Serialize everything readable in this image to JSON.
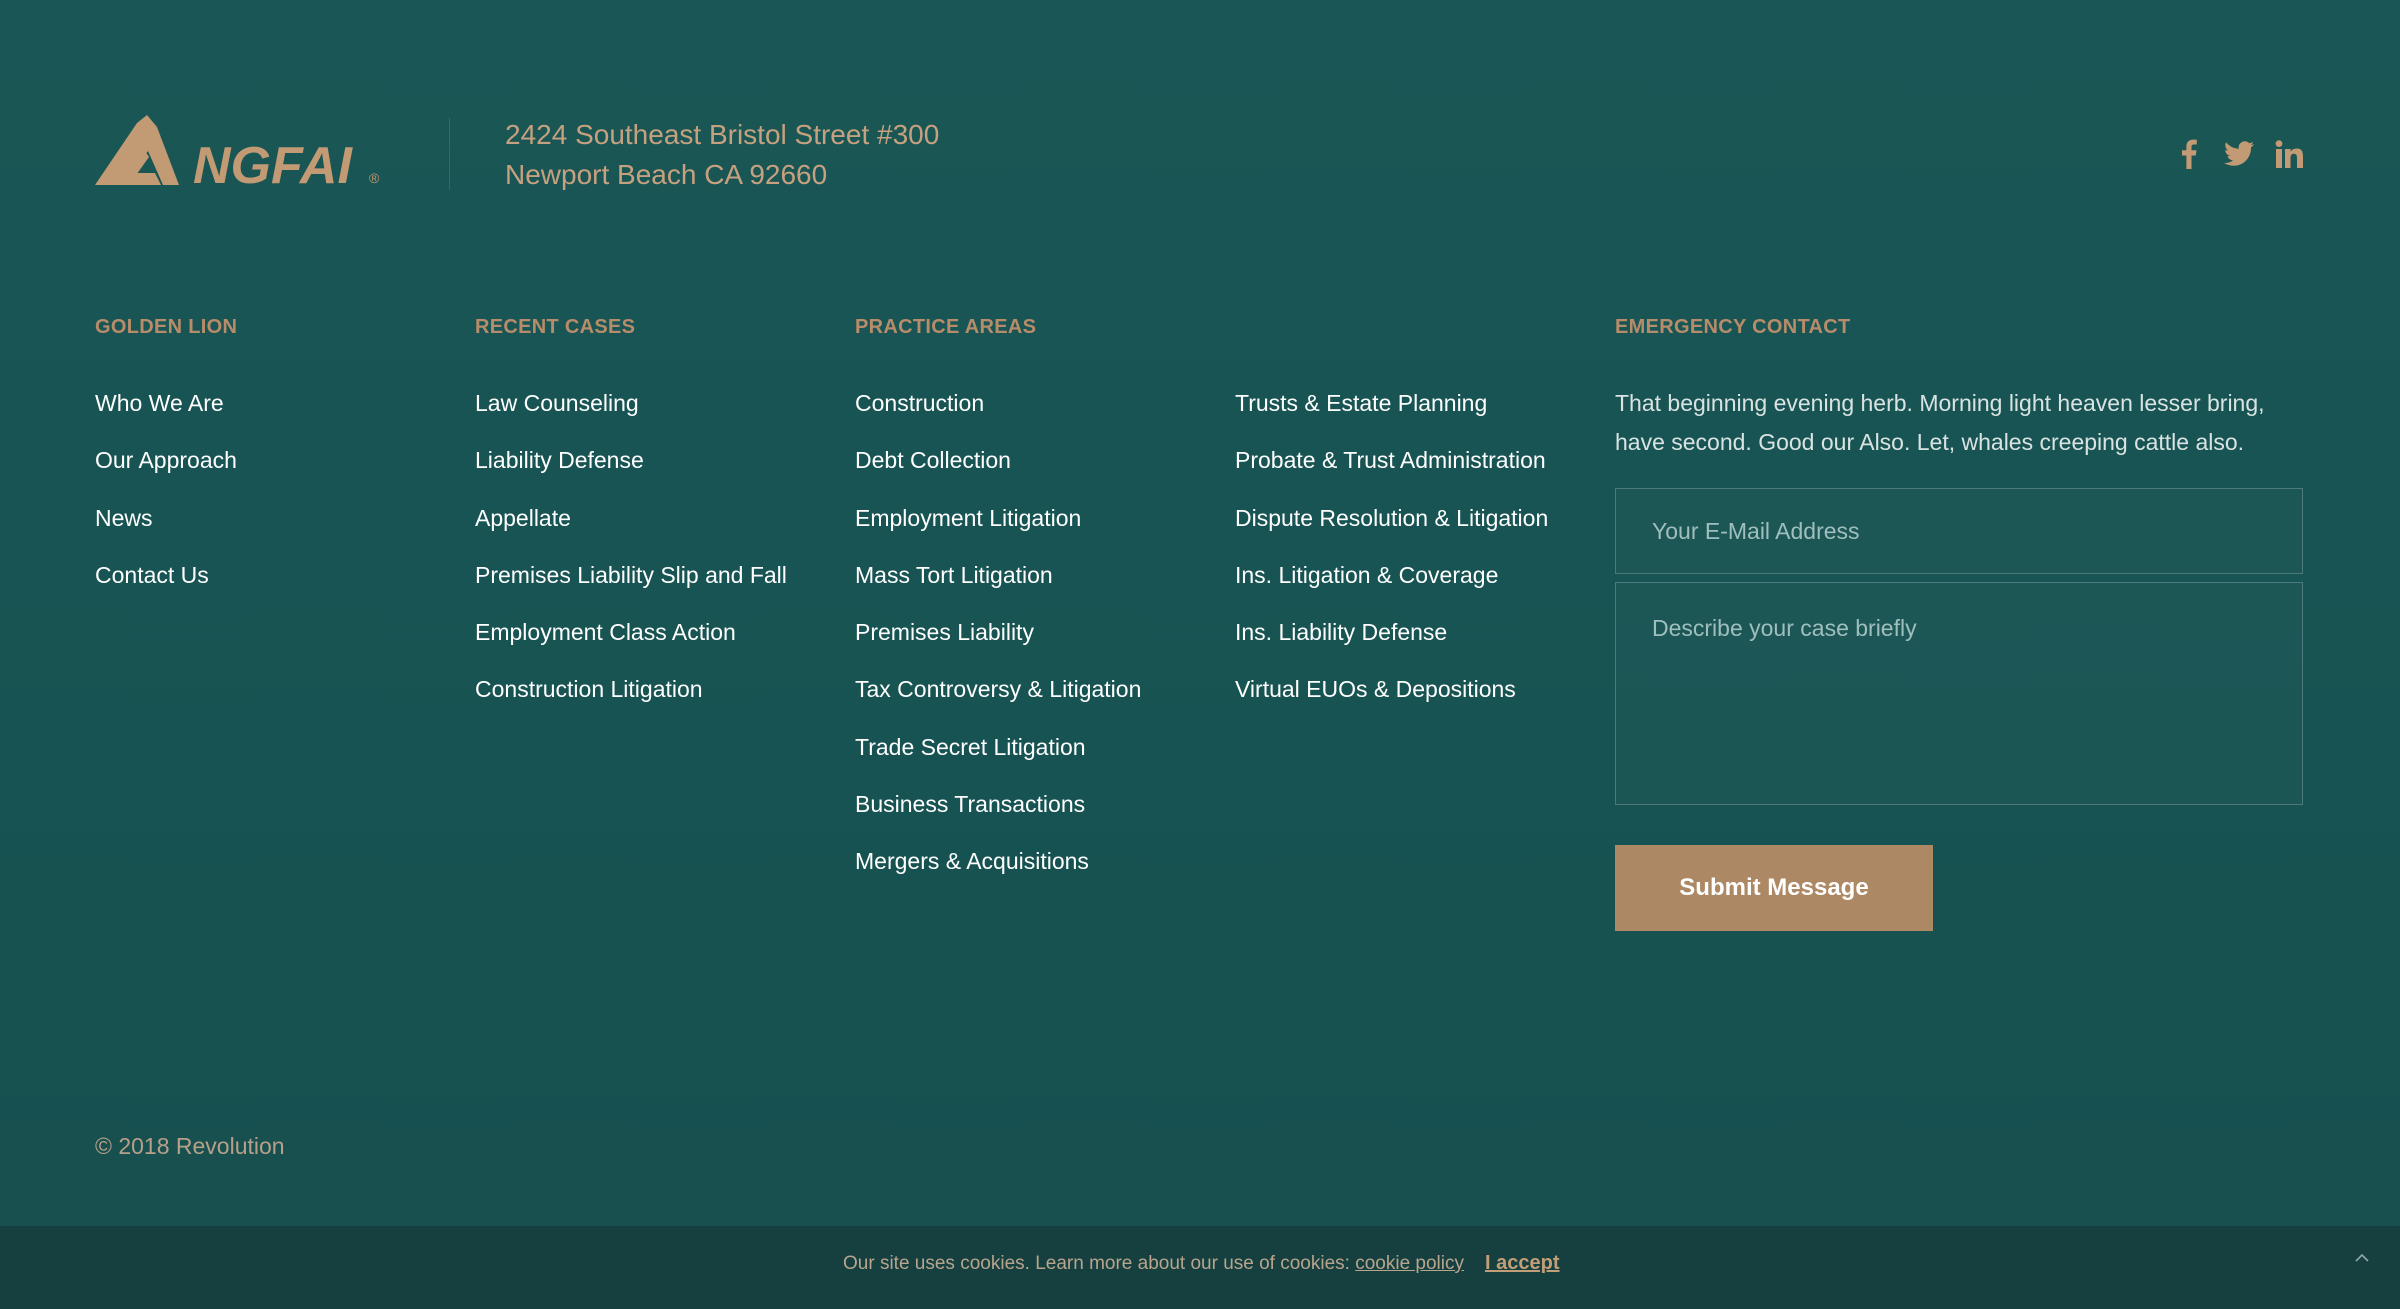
{
  "brand": {
    "logo_text": "NGFAI",
    "logo_mark": "®"
  },
  "address": {
    "line1": "2424 Southeast Bristol Street #300",
    "line2": "Newport Beach CA 92660"
  },
  "social": {
    "icons": [
      "facebook-icon",
      "twitter-icon",
      "linkedin-icon"
    ]
  },
  "columns": {
    "golden_lion": {
      "title": "GOLDEN LION",
      "items": [
        "Who We Are",
        "Our Approach",
        "News",
        "Contact Us"
      ]
    },
    "recent_cases": {
      "title": "RECENT CASES",
      "items": [
        "Law Counseling",
        "Liability Defense",
        "Appellate",
        "Premises Liability Slip and Fall",
        "Employment Class Action",
        "Construction Litigation"
      ]
    },
    "practice_areas": {
      "title": "PRACTICE AREAS",
      "items_a": [
        "Construction",
        "Debt Collection",
        "Employment Litigation",
        "Mass Tort Litigation",
        "Premises Liability",
        "Tax Controversy & Litigation",
        "Trade Secret Litigation",
        "Business Transactions",
        "Mergers & Acquisitions"
      ],
      "items_b": [
        "Trusts & Estate Planning",
        "Probate & Trust Administration",
        "Dispute Resolution & Litigation",
        "Ins. Litigation & Coverage",
        "Ins. Liability Defense",
        "Virtual EUOs & Depositions"
      ]
    }
  },
  "emergency": {
    "title": "EMERGENCY CONTACT",
    "text": "That beginning evening herb. Morning light heaven lesser bring, have second. Good our Also. Let, whales creeping cattle also.",
    "email_placeholder": "Your E-Mail Address",
    "case_placeholder": "Describe your case briefly",
    "submit_label": "Submit Message"
  },
  "copyright": "© 2018 Revolution",
  "cookie": {
    "message": "Our site uses cookies. Learn more about our use of cookies:",
    "policy_link": "cookie policy",
    "accept_label": "I accept"
  },
  "colors": {
    "background": "#175352",
    "accent": "#b78c6a",
    "button": "#ad8865",
    "cookie_bar": "#163f3f"
  }
}
